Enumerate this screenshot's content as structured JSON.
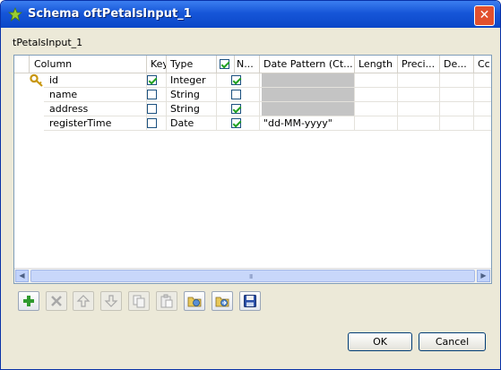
{
  "window": {
    "title": "Schema oftPetalsInput_1",
    "close_glyph": "✕"
  },
  "sub_label": "tPetalsInput_1",
  "table": {
    "columns": [
      "",
      "Column",
      "Key",
      "Type",
      "",
      "N...",
      "Date Pattern (Ct...",
      "Length",
      "Preci...",
      "De...",
      "Cc"
    ],
    "rows": [
      {
        "column": "id",
        "key": true,
        "type": "Integer",
        "nullable": true,
        "date_pattern": "",
        "has_key_icon": true
      },
      {
        "column": "name",
        "key": false,
        "type": "String",
        "nullable": false,
        "date_pattern": ""
      },
      {
        "column": "address",
        "key": false,
        "type": "String",
        "nullable": true,
        "date_pattern": ""
      },
      {
        "column": "registerTime",
        "key": false,
        "type": "Date",
        "nullable": true,
        "date_pattern": "\"dd-MM-yyyy\""
      }
    ]
  },
  "scroll": {
    "grip": "III"
  },
  "toolbar": {
    "buttons": [
      {
        "name": "add-row",
        "enabled": true
      },
      {
        "name": "delete-row",
        "enabled": false
      },
      {
        "name": "move-up",
        "enabled": false
      },
      {
        "name": "move-down",
        "enabled": false
      },
      {
        "name": "copy",
        "enabled": false
      },
      {
        "name": "paste",
        "enabled": false
      },
      {
        "name": "import",
        "enabled": true
      },
      {
        "name": "export",
        "enabled": true
      },
      {
        "name": "save",
        "enabled": true
      }
    ]
  },
  "buttons": {
    "ok": "OK",
    "cancel": "Cancel"
  },
  "colors": {
    "titlebar": "#1656d8",
    "check": "#21a121",
    "grey_cell": "#c4c4c4"
  }
}
